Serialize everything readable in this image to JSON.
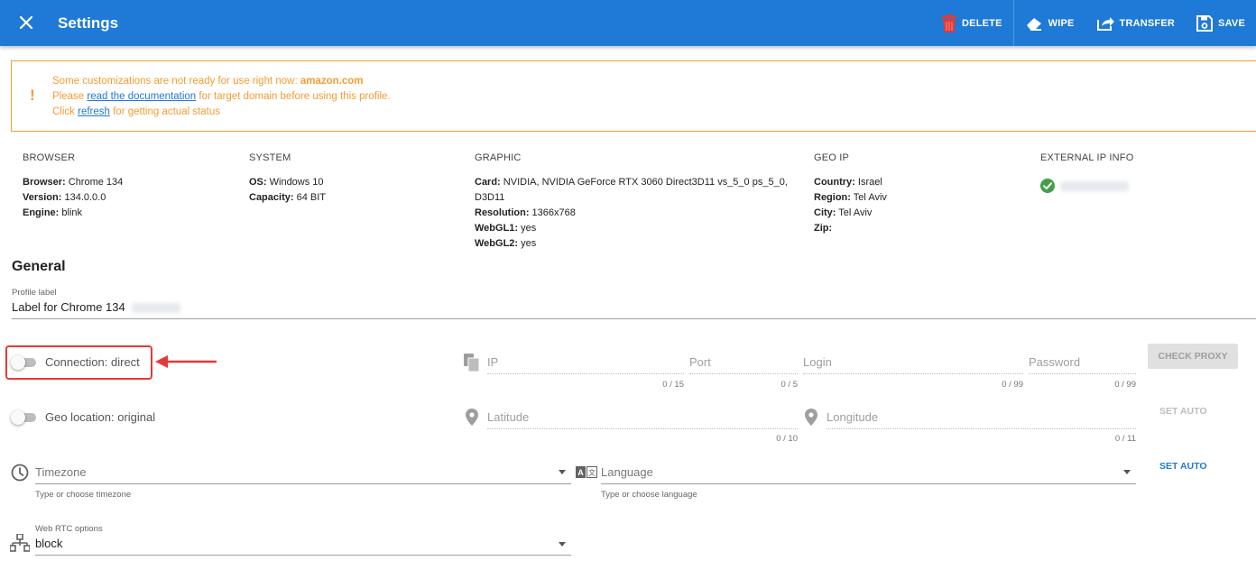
{
  "header": {
    "title": "Settings",
    "actions": {
      "delete": "DELETE",
      "wipe": "WIPE",
      "transfer": "TRANSFER",
      "save": "SAVE"
    },
    "color": "#1e7ad6"
  },
  "warning": {
    "line1_prefix": "Some customizations are not ready for use right now: ",
    "line1_domain": "amazon.com",
    "line2_prefix": "Please ",
    "line2_link": "read the documentation",
    "line2_suffix": " for target domain before using this profile.",
    "line3_prefix": "Click ",
    "line3_link": "refresh",
    "line3_suffix": " for getting actual status",
    "color": "#f39c34"
  },
  "info": {
    "browser": {
      "header": "BROWSER",
      "browser_label": "Browser:",
      "browser_value": " Chrome 134",
      "version_label": "Version:",
      "version_value": " 134.0.0.0",
      "engine_label": "Engine:",
      "engine_value": " blink"
    },
    "system": {
      "header": "SYSTEM",
      "os_label": "OS:",
      "os_value": " Windows 10",
      "capacity_label": "Capacity:",
      "capacity_value": " 64 BIT"
    },
    "graphic": {
      "header": "GRAPHIC",
      "card_label": "Card:",
      "card_value": " NVIDIA, NVIDIA GeForce RTX 3060 Direct3D11 vs_5_0 ps_5_0,",
      "card_value2": "D3D11",
      "resolution_label": "Resolution:",
      "resolution_value": " 1366x768",
      "webgl1_label": "WebGL1:",
      "webgl1_value": " yes",
      "webgl2_label": "WebGL2:",
      "webgl2_value": " yes"
    },
    "geoip": {
      "header": "GEO IP",
      "country_label": "Country:",
      "country_value": " Israel",
      "region_label": "Region:",
      "region_value": " Tel Aviv",
      "city_label": "City:",
      "city_value": " Tel Aviv",
      "zip_label": "Zip:"
    },
    "external": {
      "header": "EXTERNAL IP INFO"
    }
  },
  "general": {
    "title": "General",
    "profile_label_caption": "Profile label",
    "profile_label_value": "Label for Chrome 134",
    "connection_label": "Connection: direct",
    "geo_label": "Geo location: original",
    "proxy": {
      "ip_placeholder": "IP",
      "ip_counter": "0 / 15",
      "port_placeholder": "Port",
      "port_counter": "0 / 5",
      "login_placeholder": "Login",
      "login_counter": "0 / 99",
      "password_placeholder": "Password",
      "password_counter": "0 / 99",
      "check_button": "CHECK PROXY"
    },
    "geo": {
      "latitude_placeholder": "Latitude",
      "latitude_counter": "0 / 10",
      "longitude_placeholder": "Longitude",
      "longitude_counter": "0 / 11",
      "set_auto": "SET AUTO"
    },
    "timezone": {
      "placeholder": "Timezone",
      "hint": "Type or choose timezone"
    },
    "language": {
      "placeholder": "Language",
      "hint": "Type or choose language",
      "set_auto": "SET AUTO"
    },
    "webrtc": {
      "caption": "Web RTC options",
      "value": "block"
    }
  }
}
